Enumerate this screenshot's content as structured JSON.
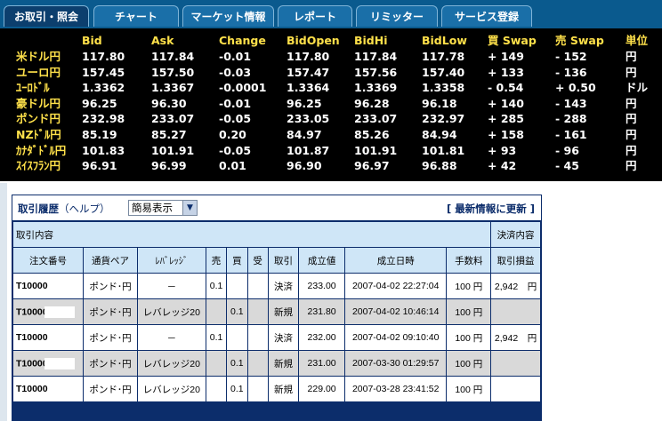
{
  "tabs": [
    {
      "label": "お取引・照会",
      "active": true
    },
    {
      "label": "チャート",
      "active": false
    },
    {
      "label": "マーケット情報",
      "active": false
    },
    {
      "label": "レポート",
      "active": false
    },
    {
      "label": "リミッター",
      "active": false
    },
    {
      "label": "サービス登録",
      "active": false
    }
  ],
  "rates": {
    "headers": [
      "Bid",
      "Ask",
      "Change",
      "BidOpen",
      "BidHi",
      "BidLow",
      "買 Swap",
      "売 Swap",
      "単位"
    ],
    "rows": [
      {
        "name": "米ドル円",
        "bid": "117.80",
        "ask": "117.84",
        "change": "-0.01",
        "open": "117.80",
        "hi": "117.84",
        "low": "117.78",
        "buy_swap": "+ 149",
        "sell_swap": "- 152",
        "unit": "円"
      },
      {
        "name": "ユーロ円",
        "bid": "157.45",
        "ask": "157.50",
        "change": "-0.03",
        "open": "157.47",
        "hi": "157.56",
        "low": "157.40",
        "buy_swap": "+ 133",
        "sell_swap": "- 136",
        "unit": "円"
      },
      {
        "name": "ﾕｰﾛﾄﾞﾙ",
        "bid": "1.3362",
        "ask": "1.3367",
        "change": "-0.0001",
        "open": "1.3364",
        "hi": "1.3369",
        "low": "1.3358",
        "buy_swap": "- 0.54",
        "sell_swap": "+ 0.50",
        "unit": "ドル"
      },
      {
        "name": "豪ドル円",
        "bid": "96.25",
        "ask": "96.30",
        "change": "-0.01",
        "open": "96.25",
        "hi": "96.28",
        "low": "96.18",
        "buy_swap": "+ 140",
        "sell_swap": "- 143",
        "unit": "円"
      },
      {
        "name": "ポンド円",
        "bid": "232.98",
        "ask": "233.07",
        "change": "-0.05",
        "open": "233.05",
        "hi": "233.07",
        "low": "232.97",
        "buy_swap": "+ 285",
        "sell_swap": "- 288",
        "unit": "円"
      },
      {
        "name": "NZﾄﾞﾙ円",
        "bid": "85.19",
        "ask": "85.27",
        "change": "0.20",
        "open": "84.97",
        "hi": "85.26",
        "low": "84.94",
        "buy_swap": "+ 158",
        "sell_swap": "- 161",
        "unit": "円"
      },
      {
        "name": "ｶﾅﾀﾞﾄﾞﾙ円",
        "bid": "101.83",
        "ask": "101.91",
        "change": "-0.05",
        "open": "101.87",
        "hi": "101.91",
        "low": "101.81",
        "buy_swap": "+ 93",
        "sell_swap": "- 96",
        "unit": "円"
      },
      {
        "name": "ｽｲｽﾌﾗﾝ円",
        "bid": "96.91",
        "ask": "96.99",
        "change": "0.01",
        "open": "96.90",
        "hi": "96.97",
        "low": "96.88",
        "buy_swap": "+ 42",
        "sell_swap": "- 45",
        "unit": "円"
      }
    ]
  },
  "history": {
    "title": "取引履歴",
    "help": "（ヘルプ）",
    "view_select": "簡易表示",
    "refresh_label": "[ 最新情報に更新 ]",
    "section_left": "取引内容",
    "section_right": "決済内容",
    "columns": [
      "注文番号",
      "通貨ペア",
      "ﾚﾊﾞﾚｯｼﾞ",
      "売",
      "買",
      "受",
      "取引",
      "成立値",
      "成立日時",
      "手数料",
      "取引損益"
    ],
    "rows": [
      {
        "order": "T10000",
        "pair": "ポンド･円",
        "leverage": "－",
        "sell": "0.1",
        "buy": "",
        "recv": "",
        "type": "決済",
        "type_kind": "settle",
        "price": "233.00",
        "datetime": "2007-04-02 22:27:04",
        "fee": "100 円",
        "pl": "2,942　円"
      },
      {
        "order": "T10000",
        "pair": "ポンド･円",
        "leverage": "レバレッジ20",
        "sell": "",
        "buy": "0.1",
        "recv": "",
        "type": "新規",
        "type_kind": "new",
        "price": "231.80",
        "datetime": "2007-04-02 10:46:14",
        "fee": "100 円",
        "pl": ""
      },
      {
        "order": "T10000",
        "pair": "ポンド･円",
        "leverage": "－",
        "sell": "0.1",
        "buy": "",
        "recv": "",
        "type": "決済",
        "type_kind": "settle",
        "price": "232.00",
        "datetime": "2007-04-02 09:10:40",
        "fee": "100 円",
        "pl": "2,942　円"
      },
      {
        "order": "T10000",
        "pair": "ポンド･円",
        "leverage": "レバレッジ20",
        "sell": "",
        "buy": "0.1",
        "recv": "",
        "type": "新規",
        "type_kind": "new",
        "price": "231.00",
        "datetime": "2007-03-30 01:29:57",
        "fee": "100 円",
        "pl": ""
      },
      {
        "order": "T10000",
        "pair": "ポンド･円",
        "leverage": "レバレッジ20",
        "sell": "",
        "buy": "0.1",
        "recv": "",
        "type": "新規",
        "type_kind": "new",
        "price": "229.00",
        "datetime": "2007-03-28 23:41:52",
        "fee": "100 円",
        "pl": ""
      }
    ]
  }
}
